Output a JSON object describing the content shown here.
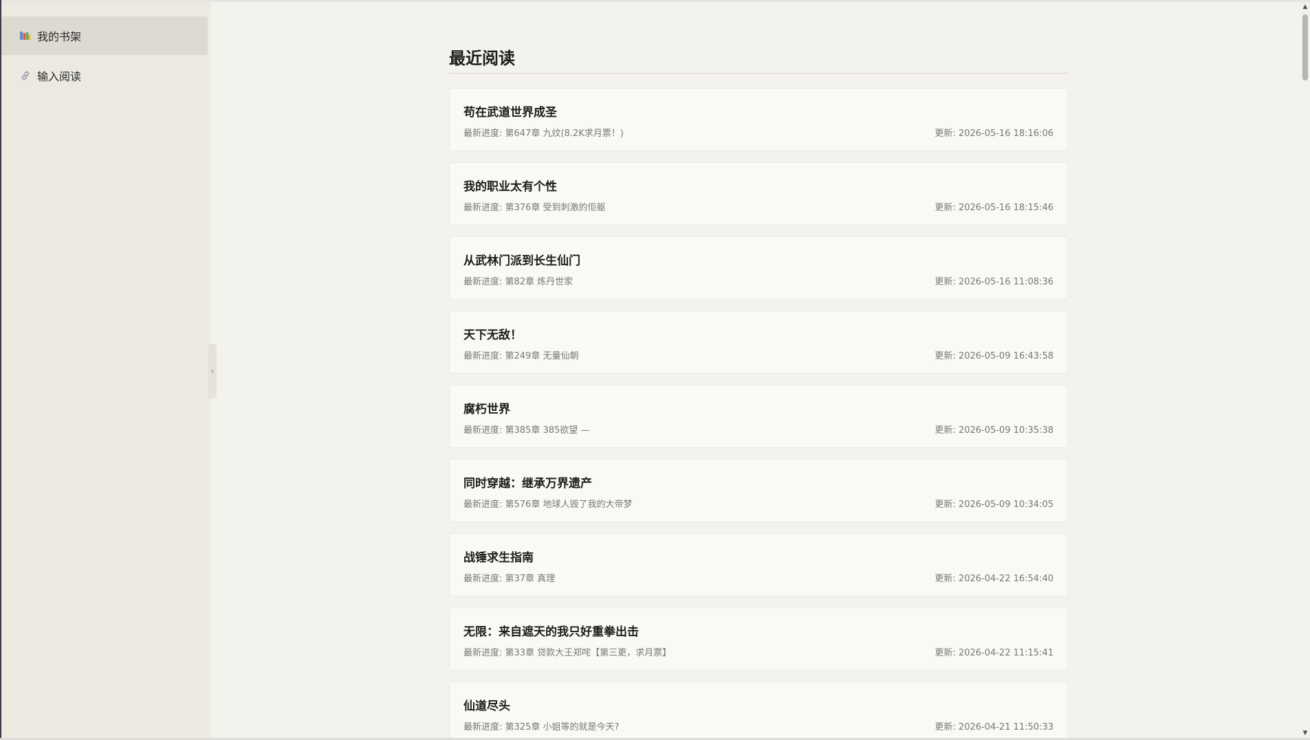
{
  "sidebar": {
    "items": [
      {
        "label": "我的书架",
        "icon": "books-icon",
        "active": true
      },
      {
        "label": "输入阅读",
        "icon": "link-icon",
        "active": false
      }
    ]
  },
  "main": {
    "title": "最近阅读",
    "books": [
      {
        "title": "苟在武道世界成圣",
        "progress": "最新进度: 第647章 九纹(8.2K求月票！)",
        "updated": "更新: 2026-05-16 18:16:06"
      },
      {
        "title": "我的职业太有个性",
        "progress": "最新进度: 第376章 受到刺激的佢躯",
        "updated": "更新: 2026-05-16 18:15:46"
      },
      {
        "title": "从武林门派到长生仙门",
        "progress": "最新进度: 第82章 炼丹世家",
        "updated": "更新: 2026-05-16 11:08:36"
      },
      {
        "title": "天下无敌！",
        "progress": "最新进度: 第249章 无量仙朝",
        "updated": "更新: 2026-05-09 16:43:58"
      },
      {
        "title": "腐朽世界",
        "progress": "最新进度: 第385章 385欲望 —",
        "updated": "更新: 2026-05-09 10:35:38"
      },
      {
        "title": "同时穿越：继承万界遗产",
        "progress": "最新进度: 第576章 地球人毁了我的大帝梦",
        "updated": "更新: 2026-05-09 10:34:05"
      },
      {
        "title": "战锤求生指南",
        "progress": "最新进度: 第37章 真理",
        "updated": "更新: 2026-04-22 16:54:40"
      },
      {
        "title": "无限：来自遮天的我只好重拳出击",
        "progress": "最新进度: 第33章 贷款大王郑咤【第三更，求月票】",
        "updated": "更新: 2026-04-22 11:15:41"
      },
      {
        "title": "仙道尽头",
        "progress": "最新进度: 第325章 小姐等的就是今天?",
        "updated": "更新: 2026-04-21 11:50:33"
      }
    ]
  }
}
